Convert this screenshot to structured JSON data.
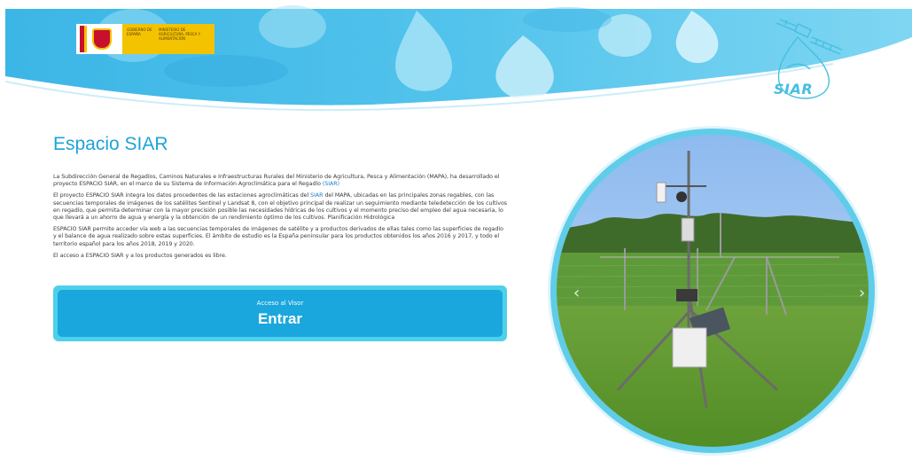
{
  "header": {
    "gov_logo": {
      "ministry_line1": "Gobierno de España",
      "ministry_line2": "Ministerio de Agricultura, Pesca y Alimentación"
    },
    "siar_logo_text": "SIAR"
  },
  "main": {
    "title": "Espacio SIAR",
    "paragraphs": {
      "p1_text": "La Subdirección General de Regadíos, Caminos Naturales e Infraestructuras Rurales del Ministerio de Agricultura, Pesca y Alimentación (MAPA), ha desarrollado el proyecto ESPACIO SIAR, en el marco de su Sistema de Información Agroclimática para el Regadío ",
      "p1_link": "(SIAR)",
      "p2_text_a": "El proyecto ESPACIO SIAR integra los datos procedentes de las estaciones agroclimáticas del ",
      "p2_link": "SIAR",
      "p2_text_b": " del MAPA, ubicadas en las principales zonas regables, con las secuencias temporales de imágenes de los satélites Sentinel y Landsat 8, con el objetivo principal de realizar un seguimiento mediante teledetección de los cultivos en regadío, que permita determinar con la mayor precisión posible las necesidades hídricas de los cultivos y el momento preciso del empleo del agua necesaria, lo que llevará a un ahorro de agua y energía y la obtención de un rendimiento óptimo de los cultivos. Planificación Hidrológica",
      "p3_text": "ESPACIO SIAR permite acceder vía web a las secuencias temporales de imágenes de satélite y a productos derivados de ellas tales como las superficies de regadío y el balance de agua realizado sobre estas superficies. El ámbito de estudio es la España peninsular para los productos obtenidos los años 2016 y 2017, y todo el territorio español para los años 2018, 2019 y 2020.",
      "p4_text": "El acceso a ESPACIO SIAR y a los productos generados es libre."
    },
    "cta": {
      "subtitle": "Acceso al Visor",
      "label": "Entrar"
    }
  },
  "carousel": {
    "prev_glyph": "‹",
    "next_glyph": "›"
  },
  "colors": {
    "accent": "#1ea3d6",
    "cta_outer": "#4dd0ea",
    "cta_inner": "#1aa7dd",
    "link": "#1a7fd1"
  }
}
